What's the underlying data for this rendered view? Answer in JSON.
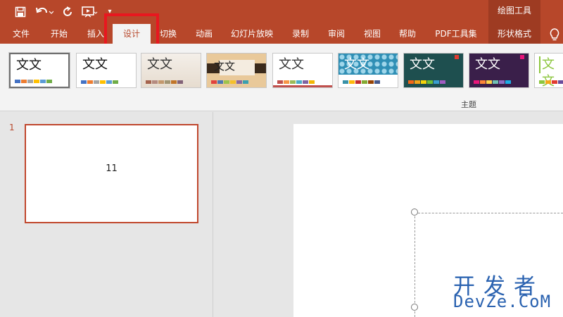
{
  "window": {
    "contextual_group": "绘图工具"
  },
  "tabs": [
    {
      "label": "文件"
    },
    {
      "label": "开始"
    },
    {
      "label": "插入"
    },
    {
      "label": "设计"
    },
    {
      "label": "切换"
    },
    {
      "label": "动画"
    },
    {
      "label": "幻灯片放映"
    },
    {
      "label": "录制"
    },
    {
      "label": "审阅"
    },
    {
      "label": "视图"
    },
    {
      "label": "帮助"
    },
    {
      "label": "PDF工具集"
    },
    {
      "label": "形状格式"
    }
  ],
  "ribbon": {
    "group_label": "主题",
    "themes": [
      {
        "text": "文文",
        "colors": [
          "#4472c4",
          "#ed7d31",
          "#a5a5a5",
          "#ffc000",
          "#5b9bd5",
          "#70ad47"
        ]
      },
      {
        "text": "文文",
        "colors": [
          "#4472c4",
          "#ed7d31",
          "#a5a5a5",
          "#ffc000",
          "#5b9bd5",
          "#70ad47"
        ]
      },
      {
        "text": "文文",
        "colors": [
          "#a5644e",
          "#b58b80",
          "#c3986d",
          "#a19574",
          "#c17529",
          "#826277"
        ]
      },
      {
        "text": "文文",
        "colors": [
          "#e1423d",
          "#4e78b2",
          "#9ec34c",
          "#f5c02a",
          "#8a6a9e",
          "#3aa0b0"
        ]
      },
      {
        "text": "文文",
        "colors": [
          "#c0504d",
          "#f79646",
          "#9bbb59",
          "#4bacc6",
          "#8064a2",
          "#f2b705"
        ]
      },
      {
        "text": "文文",
        "colors": [
          "#3891a7",
          "#feb80a",
          "#c32d2e",
          "#84aa33",
          "#964305",
          "#475a8d"
        ]
      },
      {
        "text": "文文",
        "colors": [
          "#f56617",
          "#f2a419",
          "#f5d30a",
          "#6ec038",
          "#3a9ecf",
          "#a05bc1"
        ]
      },
      {
        "text": "文文",
        "colors": [
          "#ea157a",
          "#fe8637",
          "#ffd44a",
          "#70c0b3",
          "#8f6fc4",
          "#1cade4"
        ]
      },
      {
        "text": "文文",
        "colors": [
          "#8cc63e",
          "#f5a819",
          "#e03c31",
          "#6a4c9c",
          "#1aa3d1",
          "#ffd400"
        ]
      }
    ]
  },
  "slides": [
    {
      "number": "1",
      "text": "11"
    }
  ],
  "watermark": {
    "line1": "开发者",
    "line2": "DevZe.CoM"
  },
  "colors": {
    "accent": "#b7472a",
    "highlight": "#e8171f"
  }
}
